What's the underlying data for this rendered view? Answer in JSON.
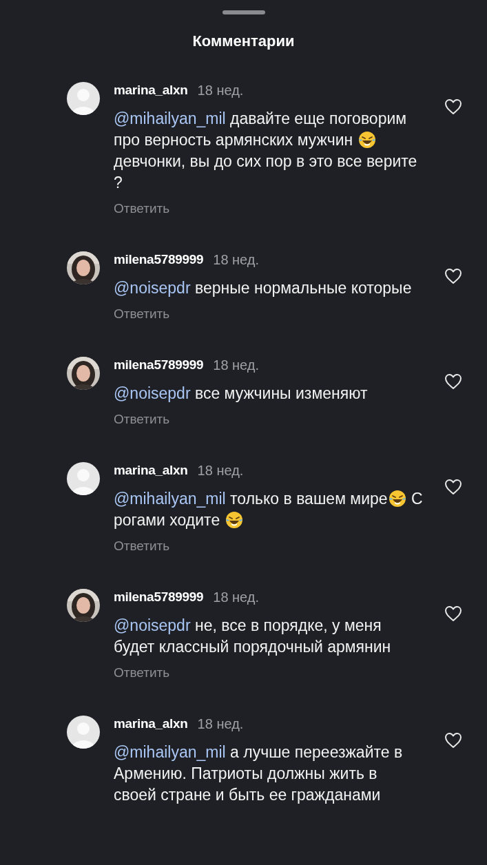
{
  "title": "Комментарии",
  "comments": [
    {
      "avatar": {
        "kind": "default"
      },
      "username": "marina_alxn",
      "time": "18 нед.",
      "parts": [
        {
          "kind": "mention",
          "text": "@mihailyan_mil"
        },
        {
          "kind": "text",
          "text": " давайте еще поговорим про верность армянских мужчин "
        },
        {
          "kind": "emoji"
        },
        {
          "kind": "text",
          "text": " девчонки, вы до сих пор в это все верите ?"
        }
      ],
      "reply": "Ответить",
      "liked": false
    },
    {
      "username": "milena5789999",
      "time": "18 нед.",
      "parts": [
        {
          "kind": "mention",
          "text": "@noisepdr"
        },
        {
          "kind": "text",
          "text": " верные нормальные которые"
        }
      ],
      "reply": "Ответить",
      "liked": false
    },
    {
      "username": "milena5789999",
      "time": "18 нед.",
      "parts": [
        {
          "kind": "mention",
          "text": "@noisepdr"
        },
        {
          "kind": "text",
          "text": " все мужчины изменяют"
        }
      ],
      "reply": "Ответить",
      "liked": false
    },
    {
      "avatar": {
        "kind": "default"
      },
      "username": "marina_alxn",
      "time": "18 нед.",
      "parts": [
        {
          "kind": "mention",
          "text": "@mihailyan_mil"
        },
        {
          "kind": "text",
          "text": " только в вашем мире"
        },
        {
          "kind": "emoji"
        },
        {
          "kind": "text",
          "text": " С рогами ходите "
        },
        {
          "kind": "emoji"
        }
      ],
      "reply": "Ответить",
      "liked": false
    },
    {
      "username": "milena5789999",
      "time": "18 нед.",
      "parts": [
        {
          "kind": "mention",
          "text": "@noisepdr"
        },
        {
          "kind": "text",
          "text": " не, все в порядке, у меня будет классный порядочный армянин"
        }
      ],
      "reply": "Ответить",
      "liked": false
    },
    {
      "avatar": {
        "kind": "default"
      },
      "username": "marina_alxn",
      "time": "18 нед.",
      "parts": [
        {
          "kind": "mention",
          "text": "@mihailyan_mil"
        },
        {
          "kind": "text",
          "text": " а лучше переезжайте в Армению. Патриоты должны жить в своей стране и быть ее гражданами"
        }
      ],
      "liked": false
    }
  ]
}
